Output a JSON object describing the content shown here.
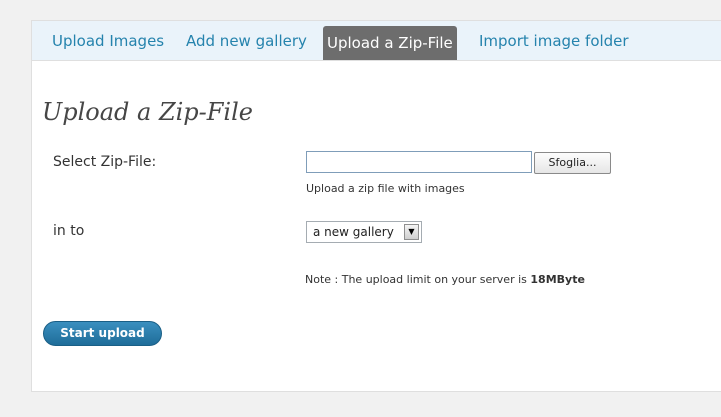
{
  "tabs": [
    {
      "label": "Upload Images"
    },
    {
      "label": "Add new gallery"
    },
    {
      "label": "Upload a Zip-File"
    },
    {
      "label": "Import image folder"
    }
  ],
  "page_title": "Upload a Zip-File",
  "form": {
    "zip_label": "Select Zip-File:",
    "file_value": "",
    "browse_label": "Sfoglia...",
    "zip_hint": "Upload a zip file with images",
    "into_label": "in to",
    "gallery_select": "a new gallery",
    "note_prefix": "Note : The upload limit on your server is ",
    "note_limit": "18MByte",
    "submit_label": "Start upload"
  },
  "icons": {
    "dropdown_arrow": "chevron-down-icon"
  }
}
